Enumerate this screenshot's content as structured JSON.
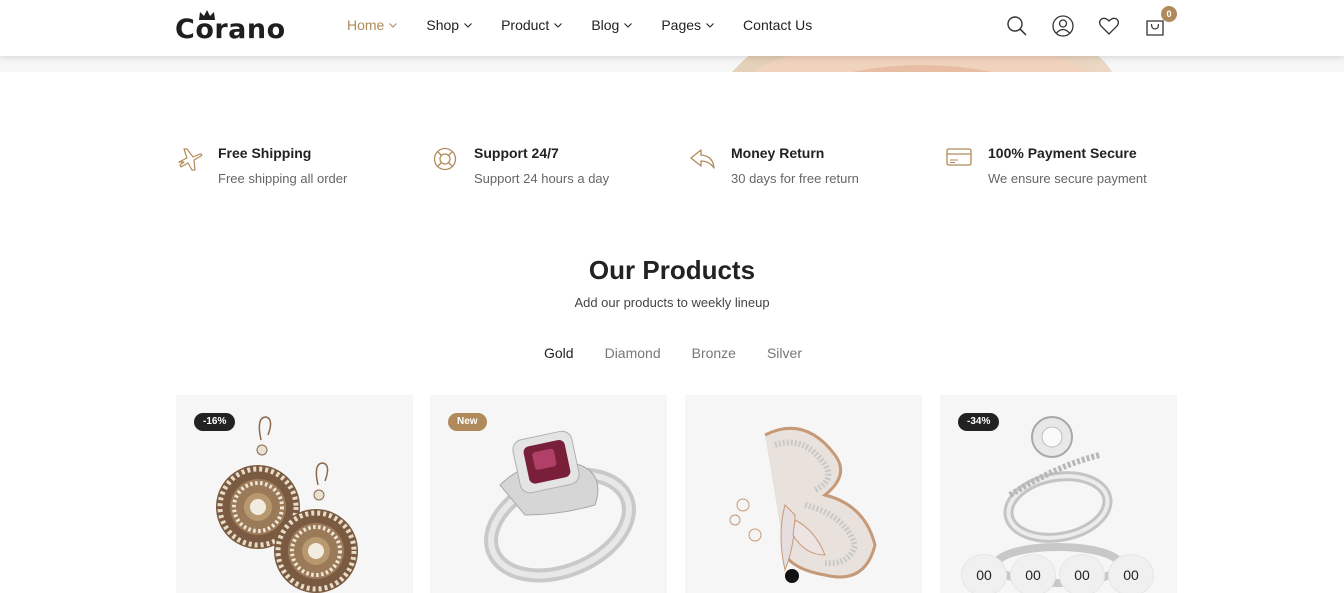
{
  "brand": {
    "logo_text": "Corano"
  },
  "nav": {
    "items": [
      {
        "label": "Home",
        "active": true
      },
      {
        "label": "Shop",
        "active": false
      },
      {
        "label": "Product",
        "active": false
      },
      {
        "label": "Blog",
        "active": false
      },
      {
        "label": "Pages",
        "active": false
      },
      {
        "label": "Contact Us",
        "active": false
      }
    ]
  },
  "header_icons": {
    "search": "search-icon",
    "account": "user-icon",
    "wishlist": "heart-icon",
    "cart": "shopping-bag-icon",
    "cart_count": "0"
  },
  "features": [
    {
      "icon": "airplane-icon",
      "title": "Free Shipping",
      "desc": "Free shipping all order"
    },
    {
      "icon": "lifebuoy-icon",
      "title": "Support 24/7",
      "desc": "Support 24 hours a day"
    },
    {
      "icon": "return-arrow-icon",
      "title": "Money Return",
      "desc": "30 days for free return"
    },
    {
      "icon": "credit-card-icon",
      "title": "100% Payment Secure",
      "desc": "We ensure secure payment"
    }
  ],
  "products_section": {
    "title": "Our Products",
    "subtitle": "Add our products to weekly lineup",
    "tabs": [
      {
        "label": "Gold",
        "active": true
      },
      {
        "label": "Diamond",
        "active": false
      },
      {
        "label": "Bronze",
        "active": false
      },
      {
        "label": "Silver",
        "active": false
      }
    ]
  },
  "products": [
    {
      "badge": "-16%",
      "image": "earrings"
    },
    {
      "badge": "New",
      "image": "ruby-ring"
    },
    {
      "badge": "",
      "image": "butterfly-brooch"
    },
    {
      "badge": "-34%",
      "image": "diamond-ring-set",
      "countdown": [
        "00",
        "00",
        "00",
        "00"
      ]
    }
  ],
  "colors": {
    "accent": "#b08a5a",
    "text": "#222222",
    "muted": "#666666",
    "card_bg": "#f6f6f6"
  }
}
